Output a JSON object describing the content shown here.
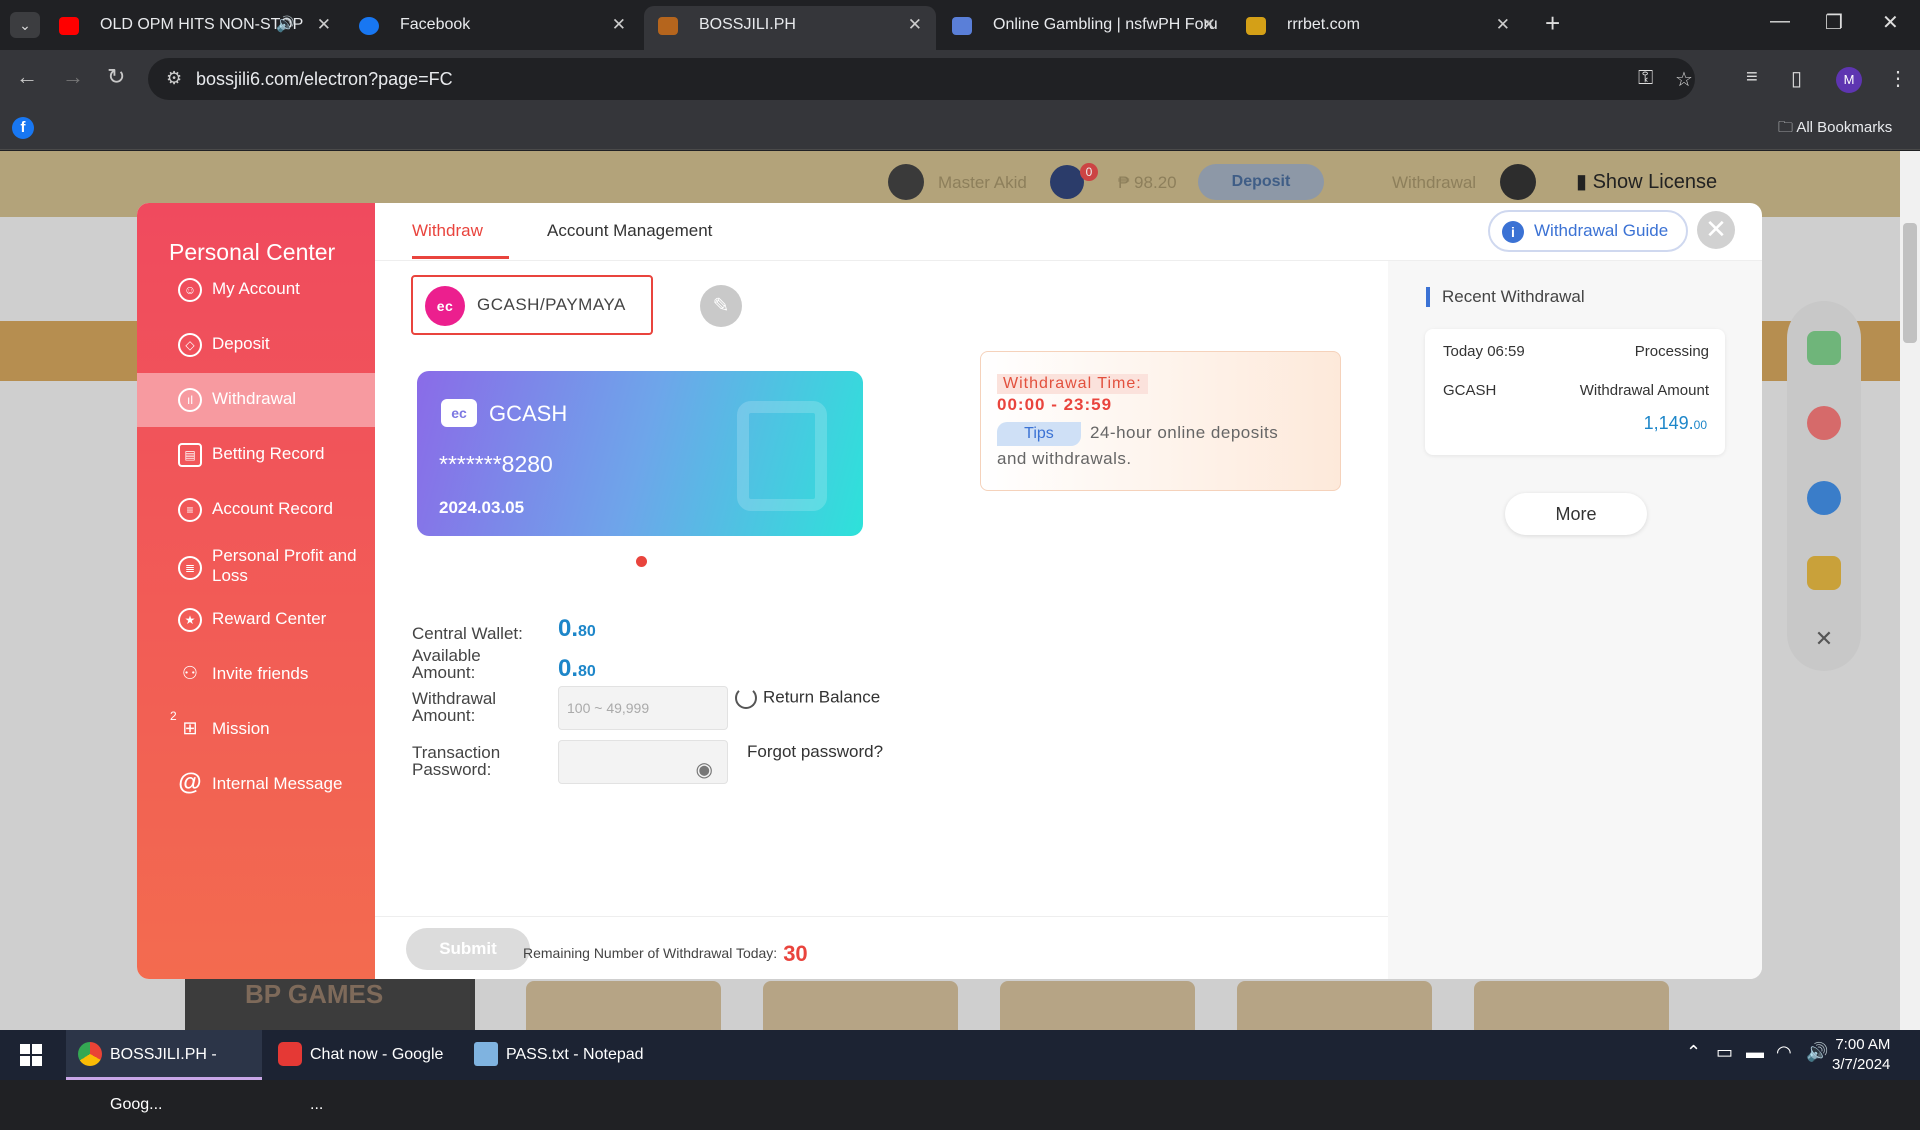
{
  "browser": {
    "tabs": [
      {
        "title": "OLD OPM HITS NON-STOP",
        "color": "#ff0000"
      },
      {
        "title": "Facebook",
        "color": "#1877f2"
      },
      {
        "title": "BOSSJILI.PH",
        "color": "#b5651d"
      },
      {
        "title": "Online Gambling | nsfwPH Foru",
        "color": "#5a7fd8"
      },
      {
        "title": "rrrbet.com",
        "color": "#d4a017"
      }
    ],
    "url": "bossjili6.com/electron?page=FC",
    "avatar_initial": "M",
    "all_bookmarks": "All Bookmarks"
  },
  "site_header": {
    "username": "Master Akid",
    "mail_count": "0",
    "balance": "₱ 98.20",
    "deposit": "Deposit",
    "withdrawal": "Withdrawal",
    "show_license": "Show License"
  },
  "background": {
    "bp_games": "BP GAMES"
  },
  "sidebar": {
    "title": "Personal Center",
    "mission_badge": "2",
    "items": [
      {
        "label": "My Account",
        "icon": "user-icon"
      },
      {
        "label": "Deposit",
        "icon": "diamond-icon"
      },
      {
        "label": "Withdrawal",
        "icon": "chart-icon"
      },
      {
        "label": "Betting Record",
        "icon": "ticket-icon"
      },
      {
        "label": "Account Record",
        "icon": "list-icon"
      },
      {
        "label": "Personal Profit and Loss",
        "icon": "report-icon"
      },
      {
        "label": "Reward Center",
        "icon": "star-icon"
      },
      {
        "label": "Invite friends",
        "icon": "add-user-icon"
      },
      {
        "label": "Mission",
        "icon": "gift-icon"
      },
      {
        "label": "Internal Message",
        "icon": "at-icon"
      }
    ]
  },
  "main": {
    "tab_withdraw": "Withdraw",
    "tab_account": "Account Management",
    "guide": "Withdrawal Guide",
    "method": "GCASH/PAYMAYA",
    "card": {
      "name": "GCASH",
      "number": "*******8280",
      "date": "2024.03.05"
    },
    "notice": {
      "time_label": "Withdrawal Time:",
      "time_value": "00:00  - 23:59",
      "tips": "Tips",
      "text1": "24-hour online deposits",
      "text2": "and withdrawals."
    },
    "central_label": "Central Wallet:",
    "central_int": "0.",
    "central_dec": "80",
    "available_label1": "Available",
    "available_label2": "Amount:",
    "available_int": "0.",
    "available_dec": "80",
    "withdraw_label1": "Withdrawal",
    "withdraw_label2": "Amount:",
    "withdraw_placeholder": "100 ~ 49,999",
    "return_balance": "Return Balance",
    "pwd_label1": "Transaction",
    "pwd_label2": "Password:",
    "forgot": "Forgot password?",
    "submit": "Submit",
    "remaining_label": "Remaining Number of Withdrawal Today:",
    "remaining_value": "30"
  },
  "recent": {
    "title": "Recent Withdrawal",
    "time": "Today 06:59",
    "status": "Processing",
    "method": "GCASH",
    "amount_label": "Withdrawal Amount",
    "amount_int": "1,149.",
    "amount_dec": "00",
    "more": "More"
  },
  "taskbar": {
    "items": [
      "BOSSJILI.PH - Goog...",
      "Chat now - Google ...",
      "PASS.txt - Notepad"
    ],
    "time": "7:00 AM",
    "date": "3/7/2024"
  }
}
